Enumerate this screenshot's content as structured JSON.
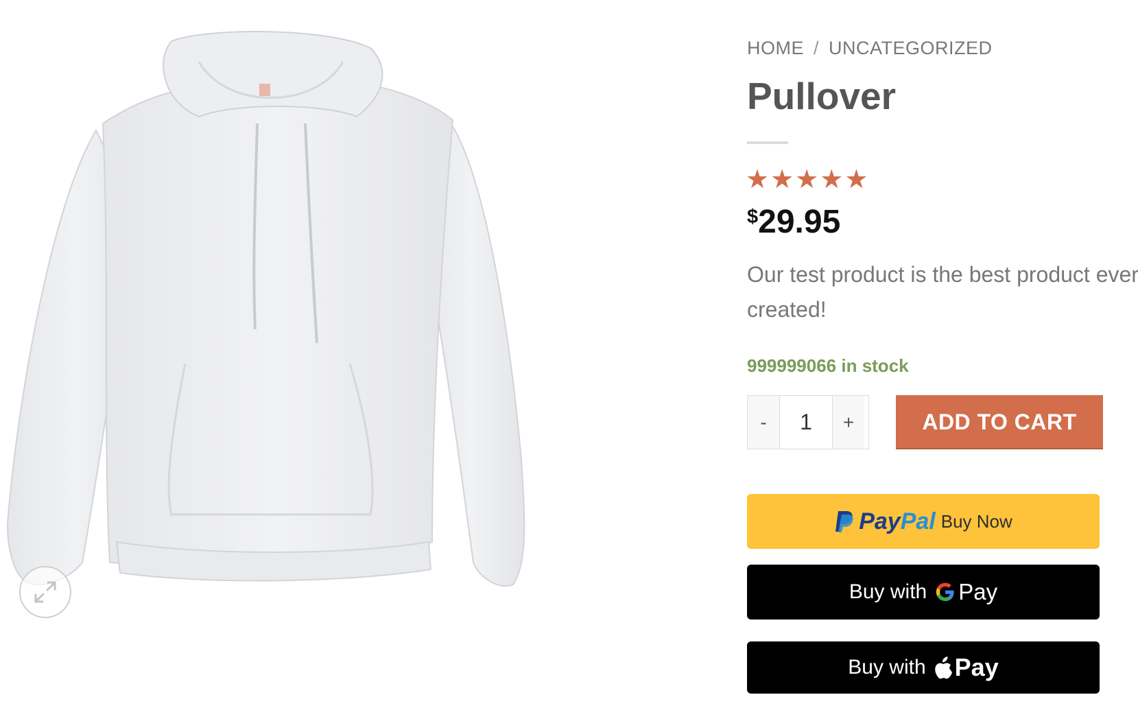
{
  "breadcrumb": {
    "home": "HOME",
    "separator": "/",
    "category": "UNCATEGORIZED"
  },
  "product": {
    "title": "Pullover",
    "rating": 5,
    "rating_max": 5,
    "price_currency": "$",
    "price_amount": "29.95",
    "description": "Our test product is the best product ever created!",
    "stock_count": "999999066",
    "stock_suffix": " in stock",
    "quantity": "1"
  },
  "cart": {
    "minus": "-",
    "plus": "+",
    "add_to_cart": "ADD TO CART"
  },
  "payments": {
    "paypal": {
      "word_pay": "Pay",
      "word_pal": "Pal",
      "label": "Buy Now",
      "color": "#fec33a"
    },
    "gpay": {
      "prefix": "Buy with",
      "suffix": "Pay"
    },
    "applepay": {
      "prefix": "Buy with",
      "suffix": "Pay"
    }
  },
  "icons": {
    "zoom": "expand-icon",
    "star": "star-icon",
    "apple": "apple-icon",
    "google": "google-g-icon"
  },
  "colors": {
    "accent": "#d26e4b",
    "stock": "#7a9c59",
    "text": "#555555"
  }
}
